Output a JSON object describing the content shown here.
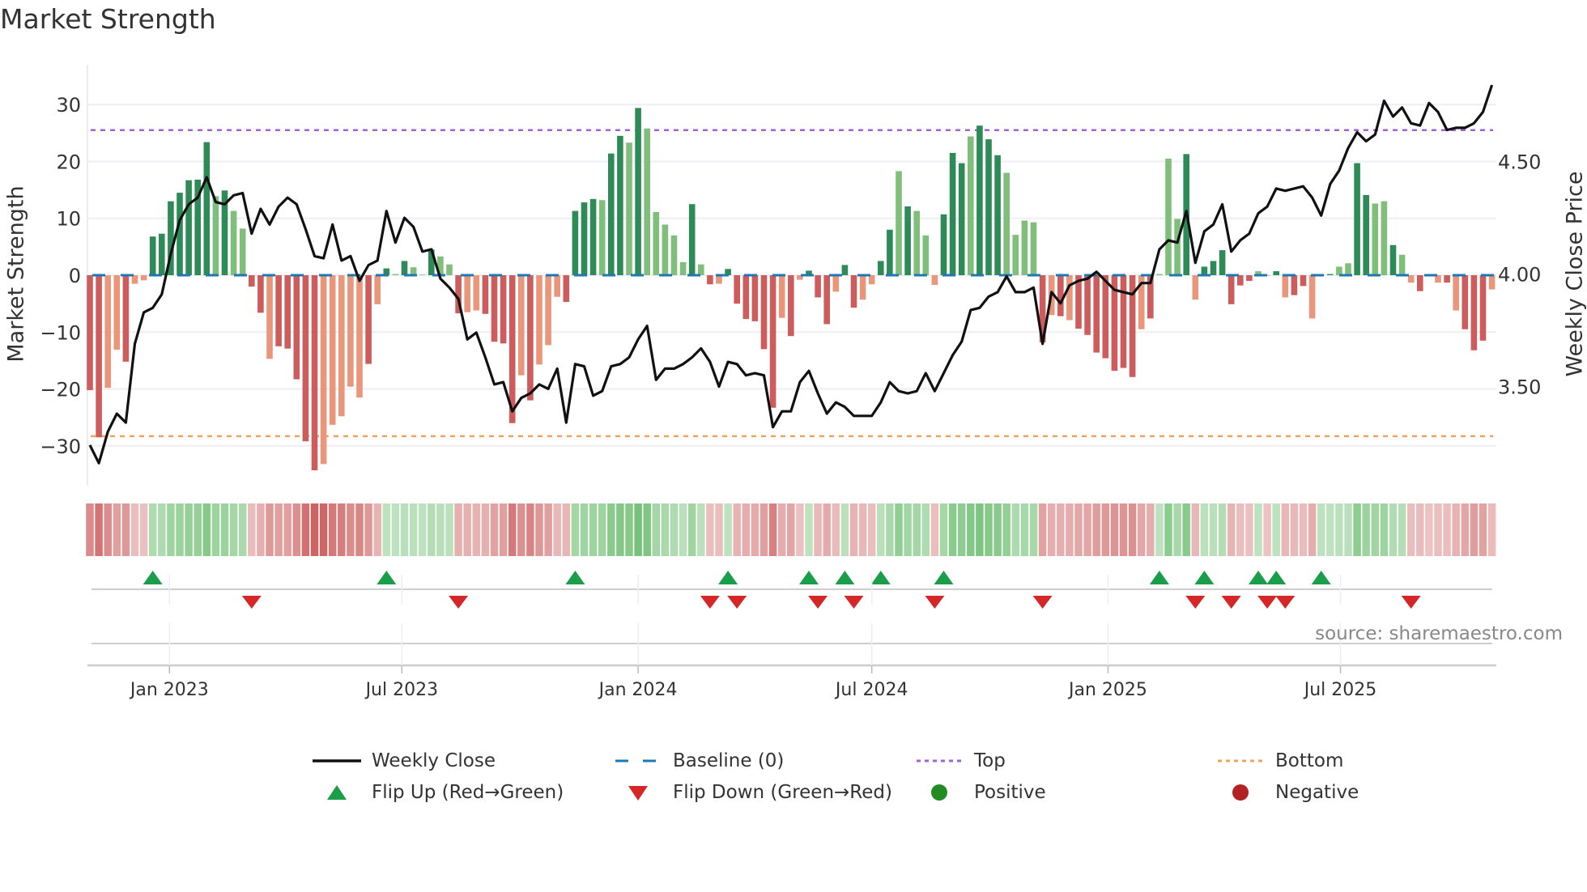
{
  "title": "Market Strength",
  "source": "source: sharemaestro.com",
  "legend": {
    "weekly_close": "Weekly Close",
    "baseline": "Baseline (0)",
    "top": "Top",
    "bottom": "Bottom",
    "flip_up": "Flip Up (Red→Green)",
    "flip_down": "Flip Down (Green→Red)",
    "positive": "Positive",
    "negative": "Negative"
  },
  "colors": {
    "pos_strong": "#2e8b57",
    "pos_weak": "#7fbf7b",
    "neg_strong": "#cd5c5c",
    "neg_weak": "#e9967a",
    "baseline": "#1f77b4",
    "top": "#a063d8",
    "bottom": "#f0a35e",
    "price": "#111111",
    "flip_up": "#1a9e4a",
    "flip_down": "#d62728",
    "positive": "#228b22",
    "negative": "#b22222"
  },
  "chart_data": {
    "type": "bar",
    "title": "Market Strength",
    "ylabel": "Market Strength",
    "y2label": "Weekly Close Price",
    "ylim": [
      -37,
      37
    ],
    "y2lim": [
      3.06,
      4.93
    ],
    "week_start": "2022-10-31",
    "top_level": 25.5,
    "bottom_level": -28.3,
    "baseline": 0,
    "y_ticks": [
      {
        "v": -30,
        "label": "−30"
      },
      {
        "v": -20,
        "label": "−20"
      },
      {
        "v": -10,
        "label": "−10"
      },
      {
        "v": 0,
        "label": "0"
      },
      {
        "v": 10,
        "label": "10"
      },
      {
        "v": 20,
        "label": "20"
      },
      {
        "v": 30,
        "label": "30"
      }
    ],
    "y2_ticks": [
      {
        "v": 3.5,
        "label": "3.50"
      },
      {
        "v": 4.0,
        "label": "4.00"
      },
      {
        "v": 4.5,
        "label": "4.50"
      }
    ],
    "x_ticks": [
      {
        "date": "2023-01-01",
        "label": "Jan 2023"
      },
      {
        "date": "2023-07-01",
        "label": "Jul 2023"
      },
      {
        "date": "2024-01-01",
        "label": "Jan 2024"
      },
      {
        "date": "2024-07-01",
        "label": "Jul 2024"
      },
      {
        "date": "2025-01-01",
        "label": "Jan 2025"
      },
      {
        "date": "2025-07-01",
        "label": "Jul 2025"
      }
    ],
    "strength": [
      -20.2,
      -28.5,
      -19.8,
      -13.1,
      -15.2,
      -1.5,
      -0.9,
      6.8,
      7.3,
      13.0,
      14.5,
      16.7,
      16.8,
      23.4,
      13.9,
      14.9,
      11.3,
      8.2,
      -2.0,
      -6.6,
      -14.7,
      -12.5,
      -12.9,
      -18.3,
      -29.2,
      -34.3,
      -33.2,
      -26.3,
      -24.8,
      -19.6,
      -21.5,
      -15.6,
      -5.1,
      1.2,
      0.2,
      2.5,
      1.4,
      0.1,
      4.5,
      3.3,
      1.9,
      -6.7,
      -6.5,
      -6.2,
      -6.8,
      -11.7,
      -12.0,
      -26.0,
      -17.6,
      -22.0,
      -15.7,
      -12.3,
      -3.8,
      -4.7,
      11.3,
      12.8,
      13.4,
      13.2,
      21.4,
      24.5,
      23.3,
      29.4,
      25.8,
      11.1,
      8.9,
      7.0,
      2.3,
      12.5,
      1.9,
      -1.6,
      -1.5,
      1.1,
      -5.0,
      -7.7,
      -8.1,
      -13.0,
      -23.3,
      -7.5,
      -10.7,
      -0.8,
      0.8,
      -3.9,
      -8.6,
      -2.9,
      1.8,
      -5.7,
      -4.3,
      -1.6,
      2.5,
      8.0,
      18.3,
      12.1,
      11.3,
      7.0,
      -1.7,
      10.7,
      21.5,
      19.7,
      24.4,
      26.3,
      23.9,
      21.1,
      18.0,
      7.1,
      9.6,
      9.3,
      -11.8,
      -7.0,
      -7.2,
      -7.9,
      -9.4,
      -10.5,
      -13.6,
      -14.6,
      -16.8,
      -16.3,
      -17.9,
      -9.5,
      -7.6,
      0.2,
      20.5,
      9.9,
      21.3,
      -4.3,
      1.5,
      2.5,
      4.4,
      -5.1,
      -1.8,
      -1.0,
      0.7,
      -0.1,
      0.7,
      -3.9,
      -3.5,
      -1.9,
      -7.6,
      0.1,
      0.2,
      1.5,
      2.1,
      19.7,
      14.1,
      12.6,
      13.0,
      5.3,
      3.6,
      -1.3,
      -2.8,
      -0.1,
      -1.3,
      -1.3,
      -6.2,
      -9.5,
      -13.2,
      -11.5,
      -2.5
    ],
    "shade": "ddlldlldddddddldllddldddddllllldldldlldlldllddddldlllddddlddldllllldldlddddddldldddlddllddldlllddd ldddlllldldldddddddldllldlddddddlldlddlldllddlldllddldldddll",
    "weekly_close": [
      3.24,
      3.16,
      3.3,
      3.38,
      3.34,
      3.69,
      3.83,
      3.85,
      3.91,
      4.09,
      4.24,
      4.31,
      4.34,
      4.43,
      4.32,
      4.31,
      4.35,
      4.36,
      4.18,
      4.29,
      4.22,
      4.3,
      4.34,
      4.31,
      4.2,
      4.08,
      4.07,
      4.22,
      4.06,
      4.08,
      3.97,
      4.04,
      4.06,
      4.28,
      4.14,
      4.25,
      4.21,
      4.1,
      4.11,
      3.98,
      3.94,
      3.89,
      3.71,
      3.74,
      3.63,
      3.51,
      3.52,
      3.39,
      3.45,
      3.47,
      3.51,
      3.49,
      3.58,
      3.34,
      3.6,
      3.59,
      3.46,
      3.48,
      3.59,
      3.6,
      3.63,
      3.71,
      3.77,
      3.53,
      3.58,
      3.58,
      3.6,
      3.63,
      3.67,
      3.61,
      3.5,
      3.61,
      3.6,
      3.55,
      3.56,
      3.55,
      3.32,
      3.39,
      3.39,
      3.52,
      3.57,
      3.47,
      3.38,
      3.43,
      3.41,
      3.37,
      3.37,
      3.37,
      3.43,
      3.52,
      3.48,
      3.47,
      3.48,
      3.56,
      3.48,
      3.56,
      3.64,
      3.7,
      3.84,
      3.85,
      3.9,
      3.92,
      3.99,
      3.92,
      3.92,
      3.94,
      3.69,
      3.92,
      3.87,
      3.95,
      3.97,
      3.98,
      4.01,
      3.97,
      3.93,
      3.92,
      3.91,
      3.96,
      3.96,
      4.11,
      4.15,
      4.14,
      4.28,
      4.05,
      4.19,
      4.22,
      4.31,
      4.1,
      4.15,
      4.18,
      4.27,
      4.3,
      4.38,
      4.37,
      4.38,
      4.39,
      4.34,
      4.26,
      4.4,
      4.46,
      4.56,
      4.63,
      4.59,
      4.62,
      4.77,
      4.7,
      4.74,
      4.67,
      4.66,
      4.76,
      4.72,
      4.64,
      4.65,
      4.65,
      4.67,
      4.72,
      4.84
    ]
  }
}
